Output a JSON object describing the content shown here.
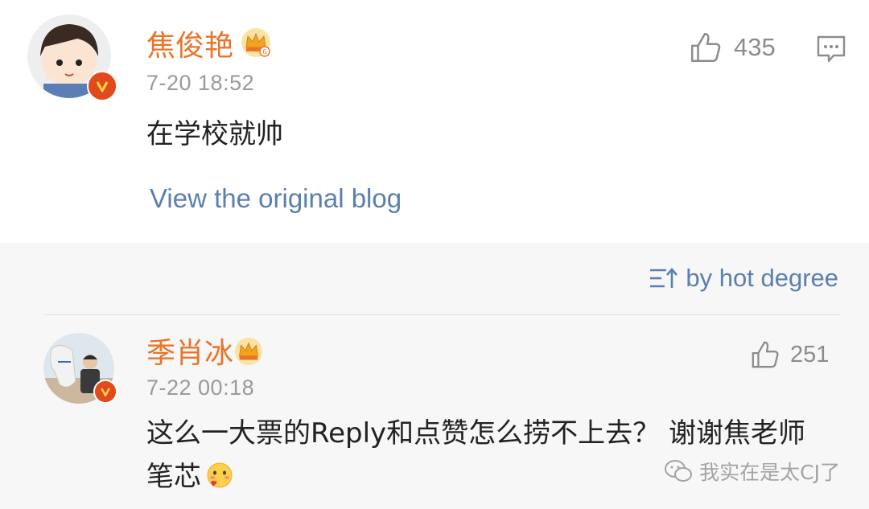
{
  "main_comment": {
    "username": "焦俊艳",
    "badge_level": "6",
    "timestamp": "7-20 18:52",
    "text": "在学校就帅",
    "likes": "435",
    "view_original": "View the original blog"
  },
  "sort": {
    "label": "by hot degree"
  },
  "reply": {
    "username": "季肖冰",
    "timestamp": "7-22 00:18",
    "text": "这么一大票的Reply和点赞怎么捞不上去？ 谢谢焦老师 笔芯",
    "likes": "251"
  },
  "watermark": {
    "text": "我实在是太CJ了"
  },
  "colors": {
    "username": "#e8752a",
    "link": "#5b7fae",
    "muted": "#9a9a9a",
    "verified_badge": "#e04a1c"
  },
  "icons": {
    "like": "thumbs-up-icon",
    "reply": "comment-bubble-icon",
    "sort": "sort-icon",
    "crown": "crown-icon",
    "verified": "verified-v-icon",
    "emoji": "blush-heart-emoji-icon",
    "watermark": "wechat-icon"
  }
}
